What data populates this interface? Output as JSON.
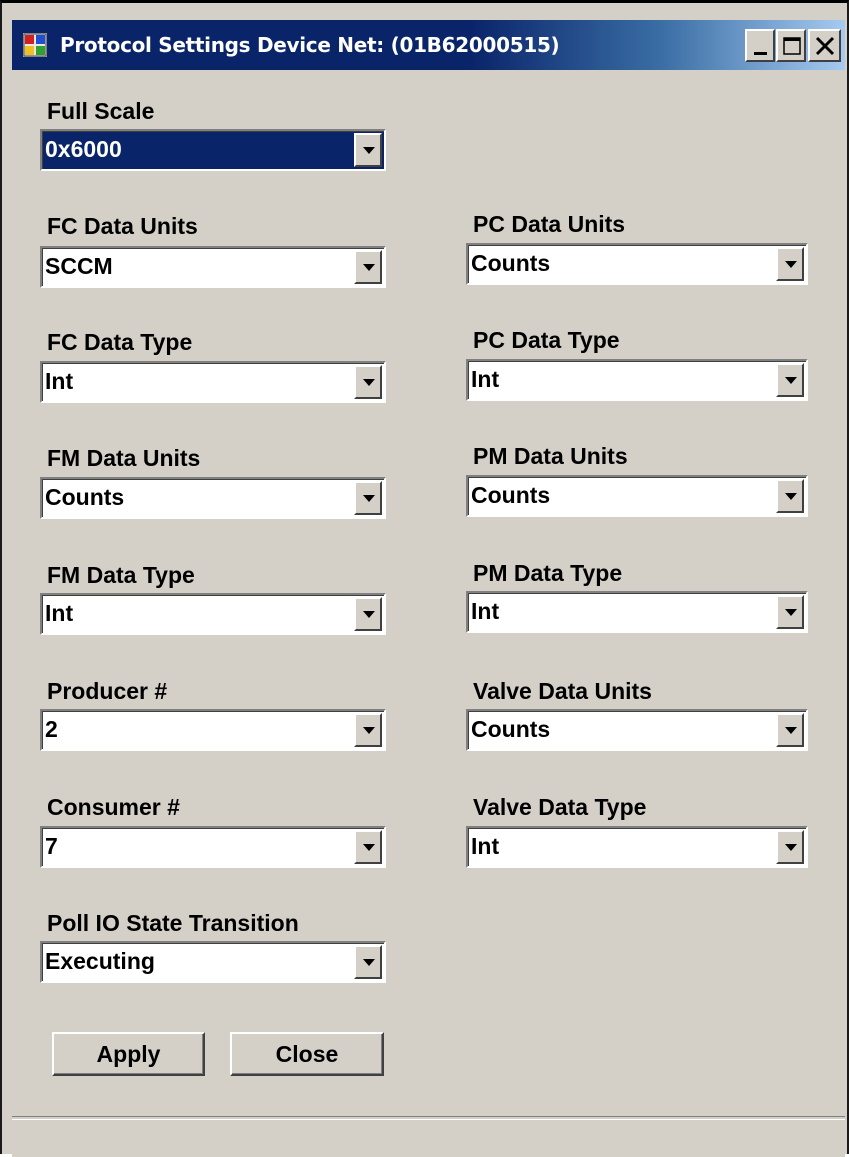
{
  "window": {
    "title": "Protocol Settings Device Net: (01B62000515)",
    "icon": "app-window-icon",
    "controls": {
      "minimize": "_",
      "maximize": "□",
      "close": "X"
    }
  },
  "fields": {
    "full_scale": {
      "label": "Full Scale",
      "value": "0x6000"
    },
    "fc_data_units": {
      "label": "FC Data Units",
      "value": "SCCM"
    },
    "pc_data_units": {
      "label": "PC Data Units",
      "value": "Counts"
    },
    "fc_data_type": {
      "label": "FC Data Type",
      "value": "Int"
    },
    "pc_data_type": {
      "label": "PC Data Type",
      "value": "Int"
    },
    "fm_data_units": {
      "label": "FM Data Units",
      "value": "Counts"
    },
    "pm_data_units": {
      "label": "PM Data Units",
      "value": "Counts"
    },
    "fm_data_type": {
      "label": "FM Data Type",
      "value": "Int"
    },
    "pm_data_type": {
      "label": "PM Data Type",
      "value": "Int"
    },
    "producer": {
      "label": "Producer #",
      "value": "2"
    },
    "valve_data_units": {
      "label": "Valve Data Units",
      "value": "Counts"
    },
    "consumer": {
      "label": "Consumer #",
      "value": "7"
    },
    "valve_data_type": {
      "label": "Valve Data Type",
      "value": "Int"
    },
    "poll_io_state": {
      "label": "Poll IO State Transition",
      "value": "Executing"
    }
  },
  "buttons": {
    "apply": "Apply",
    "close": "Close"
  },
  "colors": {
    "titlebar": "#0a246a",
    "face": "#d4d0c8",
    "selection": "#0a246a"
  }
}
